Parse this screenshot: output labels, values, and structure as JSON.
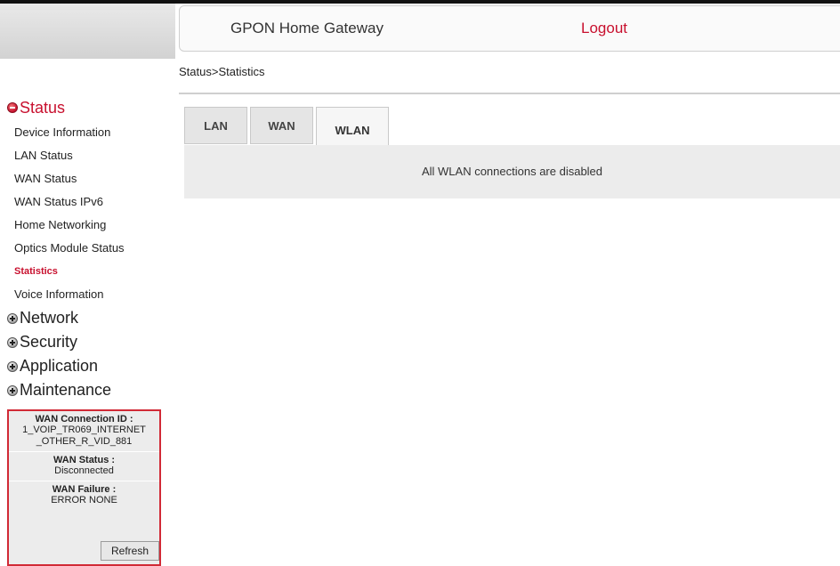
{
  "header": {
    "title": "GPON Home Gateway",
    "logout_label": "Logout"
  },
  "breadcrumb": "Status>Statistics",
  "sidebar": {
    "status_section": {
      "label": "Status",
      "items": [
        {
          "label": "Device Information"
        },
        {
          "label": "LAN Status"
        },
        {
          "label": "WAN Status"
        },
        {
          "label": "WAN Status IPv6"
        },
        {
          "label": "Home Networking"
        },
        {
          "label": "Optics Module Status"
        },
        {
          "label": "Statistics",
          "active": true
        },
        {
          "label": "Voice Information"
        }
      ]
    },
    "sections": [
      {
        "label": "Network"
      },
      {
        "label": "Security"
      },
      {
        "label": "Application"
      },
      {
        "label": "Maintenance"
      }
    ]
  },
  "wan_info": {
    "connection_id_label": "WAN Connection ID :",
    "connection_id_value": "1_VOIP_TR069_INTERNET _OTHER_R_VID_881",
    "status_label": "WAN Status :",
    "status_value": "Disconnected",
    "failure_label": "WAN Failure :",
    "failure_value": "ERROR NONE",
    "refresh_label": "Refresh"
  },
  "tabs": [
    {
      "label": "LAN"
    },
    {
      "label": "WAN"
    },
    {
      "label": "WLAN",
      "active": true
    }
  ],
  "content": {
    "message": "All WLAN connections are disabled"
  },
  "colors": {
    "accent_red": "#c8102e",
    "panel_gray": "#ececec"
  },
  "icons": {
    "status_section": "collapse-circle-icon",
    "other_sections": "expand-plus-circle-icon"
  }
}
